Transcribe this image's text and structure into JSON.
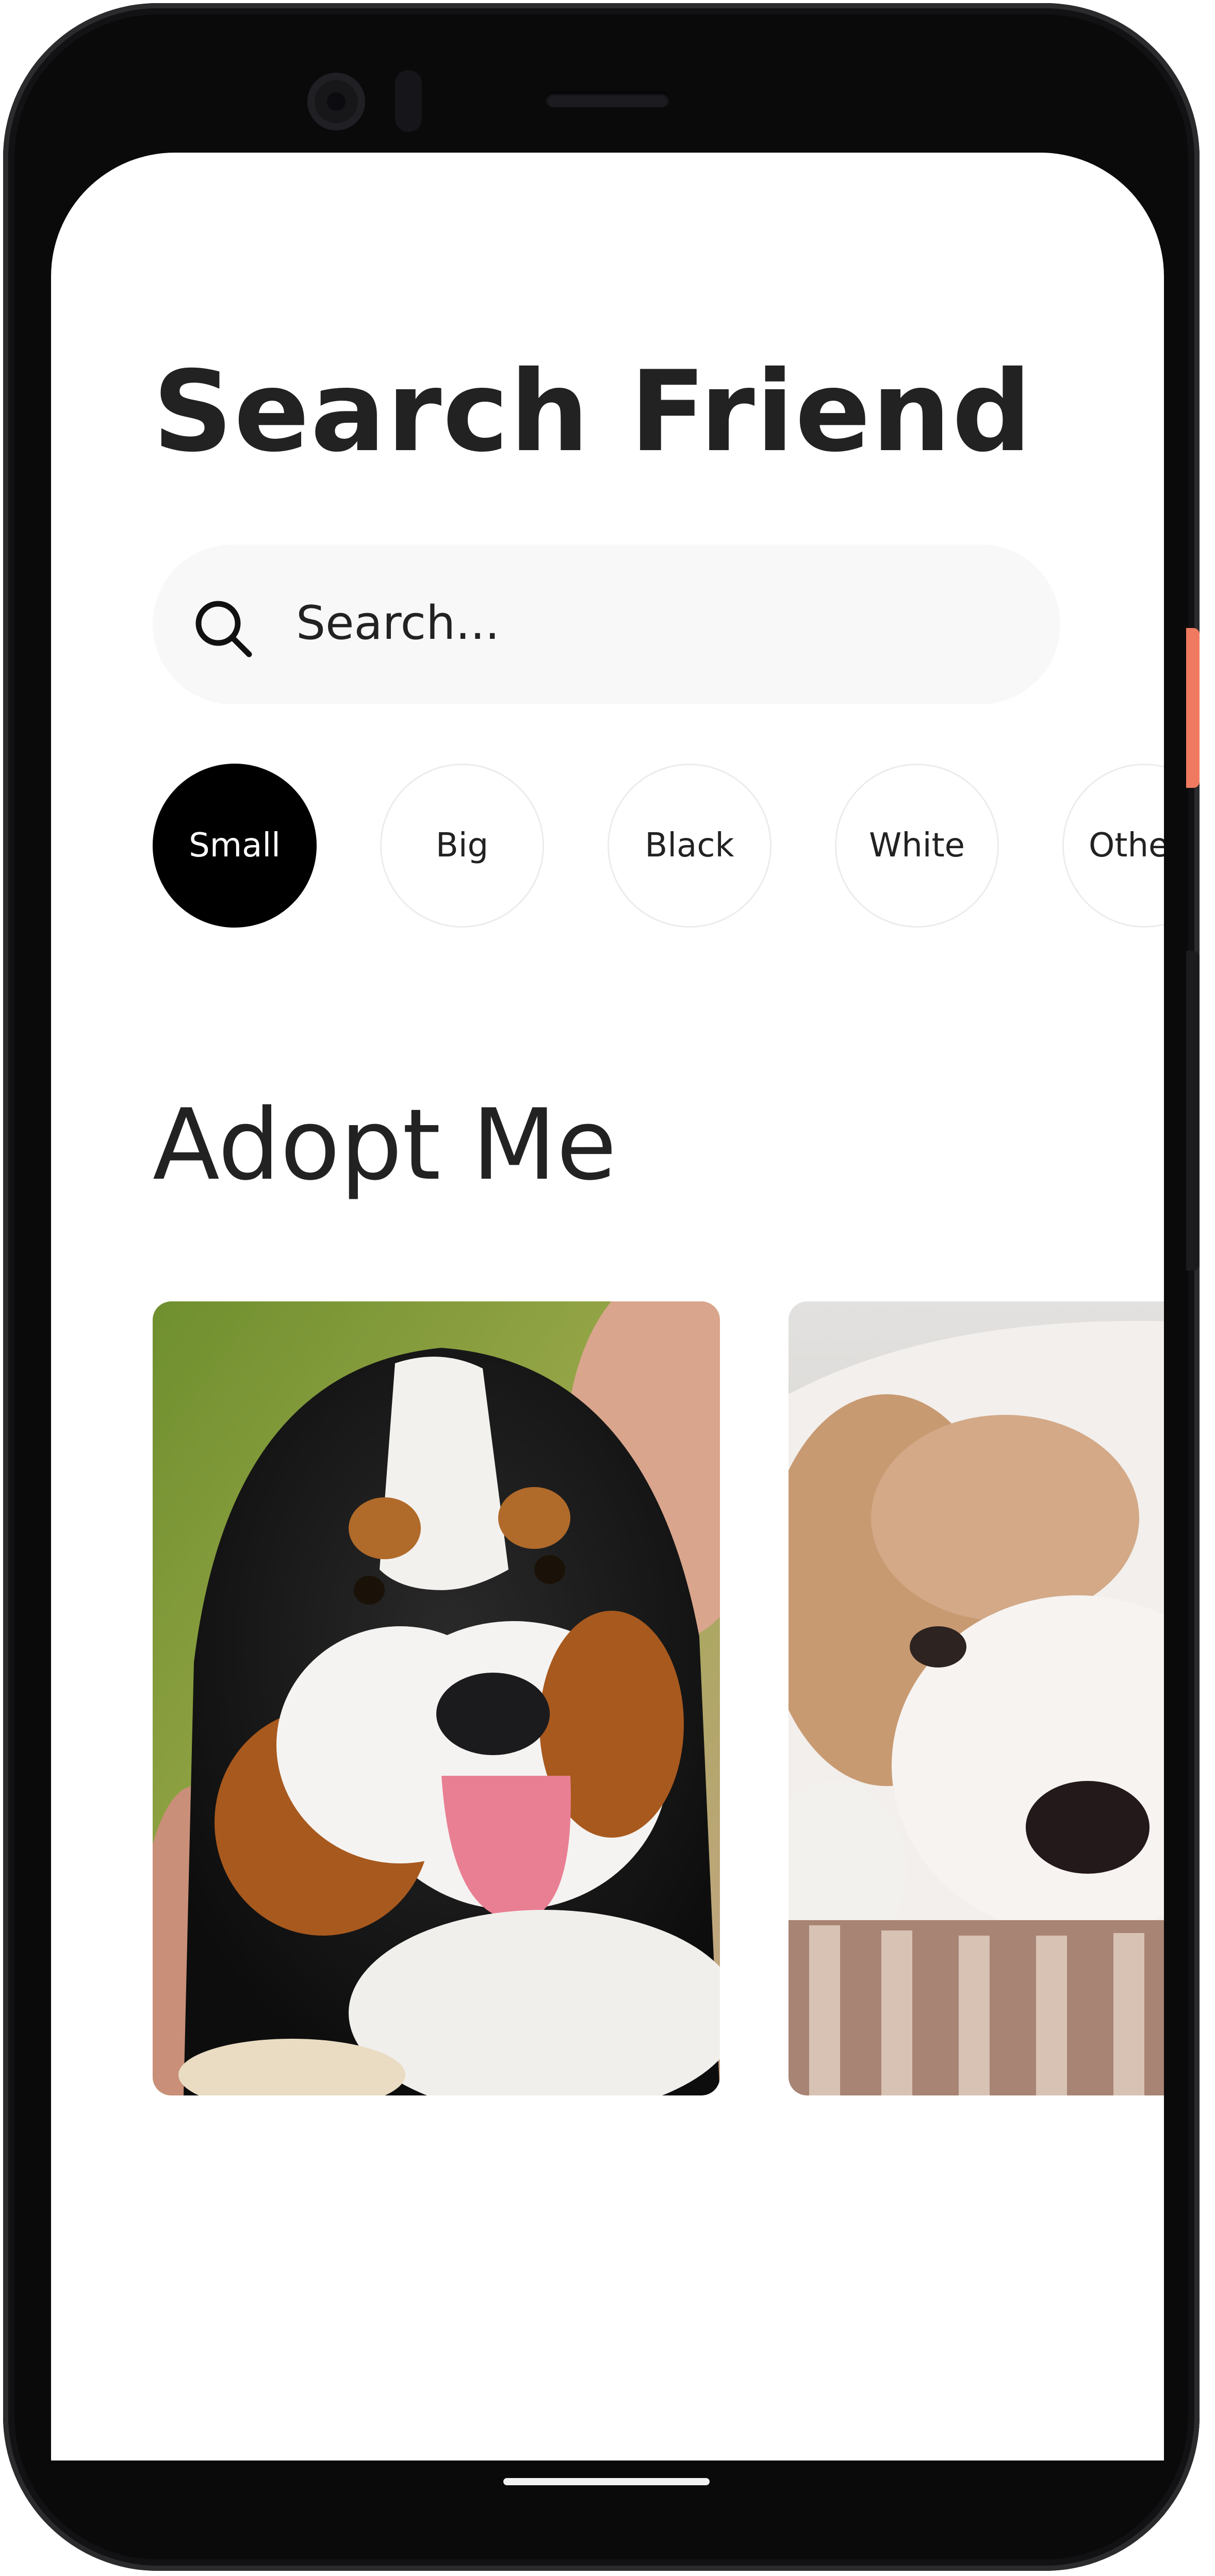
{
  "screen": {
    "title": "Search Friend",
    "search": {
      "placeholder": "Search...",
      "icon": "search-icon"
    },
    "filters": [
      {
        "label": "Small",
        "selected": true
      },
      {
        "label": "Big",
        "selected": false
      },
      {
        "label": "Black",
        "selected": false
      },
      {
        "label": "White",
        "selected": false
      },
      {
        "label": "Othe",
        "selected": false
      }
    ],
    "section_title": "Adopt Me",
    "pets": [
      {
        "photo": "tricolor-puppy-photo"
      },
      {
        "photo": "white-tan-puppy-photo"
      }
    ]
  },
  "colors": {
    "text": "#222222",
    "search_bg": "#f8f8f8",
    "chip_selected_bg": "#000000",
    "chip_selected_text": "#ffffff",
    "chip_border": "#ececec",
    "phone_frame": "#0a0a0b",
    "power_button": "#f07a5f"
  }
}
